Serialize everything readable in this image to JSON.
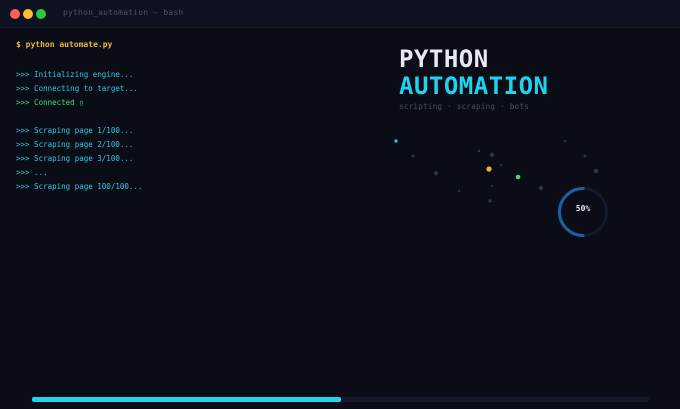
{
  "window": {
    "title": "python_automation — bash"
  },
  "terminal": {
    "command": "$ python automate.py",
    "group1": [
      {
        "text": ">>> Initializing engine...",
        "status": "info"
      },
      {
        "text": ">>> Connecting to target...",
        "status": "info"
      },
      {
        "text": ">>> Connected ▯",
        "status": "ok"
      }
    ],
    "group2": [
      {
        "text": ">>> Scraping page 1/100..."
      },
      {
        "text": ">>> Scraping page 2/100..."
      },
      {
        "text": ">>> Scraping page 3/100..."
      },
      {
        "text": ">>> ..."
      },
      {
        "text": ">>> Scraping page 100/100..."
      }
    ]
  },
  "brand": {
    "line1": "PYTHON",
    "line2": "AUTOMATION",
    "tagline": "scripting · scraping · bots"
  },
  "gauge": {
    "label": "50%",
    "value": 0.5
  },
  "progress": {
    "value": 0.5
  },
  "colors": {
    "accent": "#22d3ee",
    "ok": "#3ddc84",
    "prompt": "#f0b43c",
    "background": "#0a0d16"
  }
}
